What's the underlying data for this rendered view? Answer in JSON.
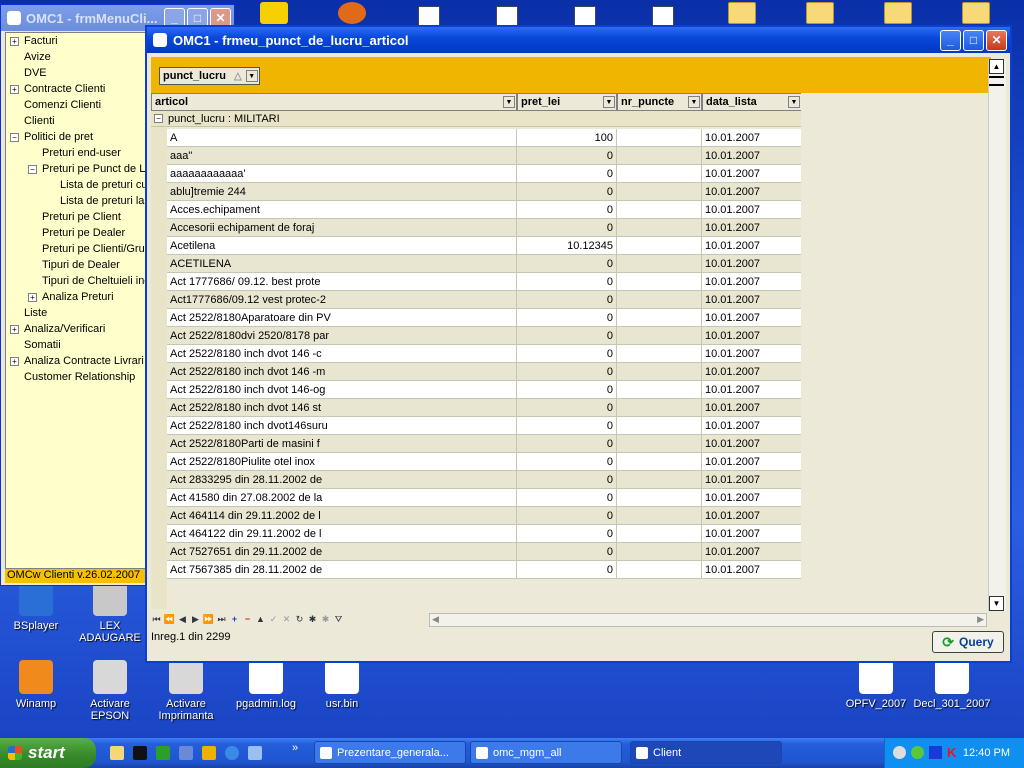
{
  "desktop_icons": [
    {
      "name": "bsplayer",
      "label": "BSplayer",
      "color": "#2a6fd6"
    },
    {
      "name": "lex-adaugare",
      "label": "LEX ADAUGARE",
      "color": "#c8c8c8"
    },
    {
      "name": "winamp",
      "label": "Winamp",
      "color": "#f08a1c"
    },
    {
      "name": "activare-epson",
      "label": "Activare EPSON",
      "color": "#d8d8d8"
    },
    {
      "name": "activare-imprimanta",
      "label": "Activare Imprimanta",
      "color": "#d8d8d8"
    },
    {
      "name": "pgadmin-log",
      "label": "pgadmin.log",
      "color": "#ffffff"
    },
    {
      "name": "usr-bin",
      "label": "usr.bin",
      "color": "#ffffff"
    },
    {
      "name": "opfv-2007",
      "label": "OPFV_2007",
      "color": "#ffffff"
    },
    {
      "name": "decl-301-2007",
      "label": "Decl_301_2007",
      "color": "#ffffff"
    }
  ],
  "menu_window": {
    "title": "OMC1 - frmMenuCli...",
    "version": "OMCw Clienti v.26.02.2007",
    "items": [
      {
        "label": "Facturi",
        "expander": "+",
        "level": 0
      },
      {
        "label": "Avize",
        "expander": "",
        "level": 0
      },
      {
        "label": "DVE",
        "expander": "",
        "level": 0
      },
      {
        "label": "Contracte Clienti",
        "expander": "+",
        "level": 0
      },
      {
        "label": "Comenzi Clienti",
        "expander": "",
        "level": 0
      },
      {
        "label": "Clienti",
        "expander": "",
        "level": 0
      },
      {
        "label": "Politici de pret",
        "expander": "−",
        "level": 0
      },
      {
        "label": "Preturi end-user",
        "expander": "",
        "level": 1
      },
      {
        "label": "Preturi pe Punct de L",
        "expander": "−",
        "level": 1
      },
      {
        "label": "Lista de preturi cu",
        "expander": "",
        "level": 2
      },
      {
        "label": "Lista de preturi la",
        "expander": "",
        "level": 2
      },
      {
        "label": "Preturi pe Client",
        "expander": "",
        "level": 1
      },
      {
        "label": "Preturi pe Dealer",
        "expander": "",
        "level": 1
      },
      {
        "label": "Preturi pe Clienti/Grup",
        "expander": "",
        "level": 1
      },
      {
        "label": "Tipuri de Dealer",
        "expander": "",
        "level": 1
      },
      {
        "label": "Tipuri de Cheltuieli inc",
        "expander": "",
        "level": 1
      },
      {
        "label": "Analiza Preturi",
        "expander": "+",
        "level": 1
      },
      {
        "label": "Liste",
        "expander": "",
        "level": 0
      },
      {
        "label": "Analiza/Verificari",
        "expander": "+",
        "level": 0
      },
      {
        "label": "Somatii",
        "expander": "",
        "level": 0
      },
      {
        "label": "Analiza Contracte Livrari",
        "expander": "+",
        "level": 0
      },
      {
        "label": "Customer Relationship",
        "expander": "",
        "level": 0
      }
    ]
  },
  "main_window": {
    "title": "OMC1 - frmeu_punct_de_lucru_articol",
    "group_chip": "punct_lucru",
    "columns": [
      {
        "key": "articol",
        "label": "articol"
      },
      {
        "key": "pret_lei",
        "label": "pret_lei"
      },
      {
        "key": "nr_puncte",
        "label": "nr_puncte"
      },
      {
        "key": "data_lista",
        "label": "data_lista"
      }
    ],
    "group_row": "punct_lucru : MILITARI",
    "rows": [
      {
        "articol": "A",
        "pret_lei": "100",
        "nr_puncte": "",
        "data_lista": "10.01.2007"
      },
      {
        "articol": "aaa\"",
        "pret_lei": "0",
        "nr_puncte": "",
        "data_lista": "10.01.2007"
      },
      {
        "articol": "aaaaaaaaaaaa'",
        "pret_lei": "0",
        "nr_puncte": "",
        "data_lista": "10.01.2007"
      },
      {
        "articol": "ablu]tremie 244",
        "pret_lei": "0",
        "nr_puncte": "",
        "data_lista": "10.01.2007"
      },
      {
        "articol": "Acces.echipament",
        "pret_lei": "0",
        "nr_puncte": "",
        "data_lista": "10.01.2007"
      },
      {
        "articol": "Accesorii echipament de foraj",
        "pret_lei": "0",
        "nr_puncte": "",
        "data_lista": "10.01.2007"
      },
      {
        "articol": "Acetilena",
        "pret_lei": "10.12345",
        "nr_puncte": "",
        "data_lista": "10.01.2007"
      },
      {
        "articol": "ACETILENA",
        "pret_lei": "0",
        "nr_puncte": "",
        "data_lista": "10.01.2007"
      },
      {
        "articol": "Act 1777686/ 09.12. best prote",
        "pret_lei": "0",
        "nr_puncte": "",
        "data_lista": "10.01.2007"
      },
      {
        "articol": "Act1777686/09.12 vest protec-2",
        "pret_lei": "0",
        "nr_puncte": "",
        "data_lista": "10.01.2007"
      },
      {
        "articol": "Act 2522/8180Aparatoare din PV",
        "pret_lei": "0",
        "nr_puncte": "",
        "data_lista": "10.01.2007"
      },
      {
        "articol": "Act 2522/8180dvi 2520/8178 par",
        "pret_lei": "0",
        "nr_puncte": "",
        "data_lista": "10.01.2007"
      },
      {
        "articol": "Act 2522/8180 inch dvot 146 -c",
        "pret_lei": "0",
        "nr_puncte": "",
        "data_lista": "10.01.2007"
      },
      {
        "articol": "Act 2522/8180 inch dvot 146 -m",
        "pret_lei": "0",
        "nr_puncte": "",
        "data_lista": "10.01.2007"
      },
      {
        "articol": "Act 2522/8180 inch dvot 146-og",
        "pret_lei": "0",
        "nr_puncte": "",
        "data_lista": "10.01.2007"
      },
      {
        "articol": "Act 2522/8180 inch dvot 146 st",
        "pret_lei": "0",
        "nr_puncte": "",
        "data_lista": "10.01.2007"
      },
      {
        "articol": "Act 2522/8180 inch dvot146suru",
        "pret_lei": "0",
        "nr_puncte": "",
        "data_lista": "10.01.2007"
      },
      {
        "articol": "Act 2522/8180Parti de masini f",
        "pret_lei": "0",
        "nr_puncte": "",
        "data_lista": "10.01.2007"
      },
      {
        "articol": "Act 2522/8180Piulite otel inox",
        "pret_lei": "0",
        "nr_puncte": "",
        "data_lista": "10.01.2007"
      },
      {
        "articol": "Act 2833295 din 28.11.2002 de",
        "pret_lei": "0",
        "nr_puncte": "",
        "data_lista": "10.01.2007"
      },
      {
        "articol": "Act 41580 din 27.08.2002 de la",
        "pret_lei": "0",
        "nr_puncte": "",
        "data_lista": "10.01.2007"
      },
      {
        "articol": "Act 464114 din 29.11.2002 de l",
        "pret_lei": "0",
        "nr_puncte": "",
        "data_lista": "10.01.2007"
      },
      {
        "articol": "Act 464122 din 29.11.2002 de l",
        "pret_lei": "0",
        "nr_puncte": "",
        "data_lista": "10.01.2007"
      },
      {
        "articol": "Act 7527651 din 29.11.2002 de",
        "pret_lei": "0",
        "nr_puncte": "",
        "data_lista": "10.01.2007"
      },
      {
        "articol": "Act 7567385 din 28.11.2002 de",
        "pret_lei": "0",
        "nr_puncte": "",
        "data_lista": "10.01.2007"
      }
    ],
    "status": "Inreg.1  din 2299",
    "query_label": "Query"
  },
  "taskbar": {
    "start_label": "start",
    "tasks": [
      {
        "label": "Prezentare_generala...",
        "active": false
      },
      {
        "label": "omc_mgm_all",
        "active": false
      },
      {
        "label": "Client",
        "active": true
      }
    ],
    "clock": "12:40 PM"
  },
  "colors": {
    "accent_yellow": "#f0b500",
    "tree_bg": "#ffffcc",
    "titlebar": "#0a49d9"
  }
}
